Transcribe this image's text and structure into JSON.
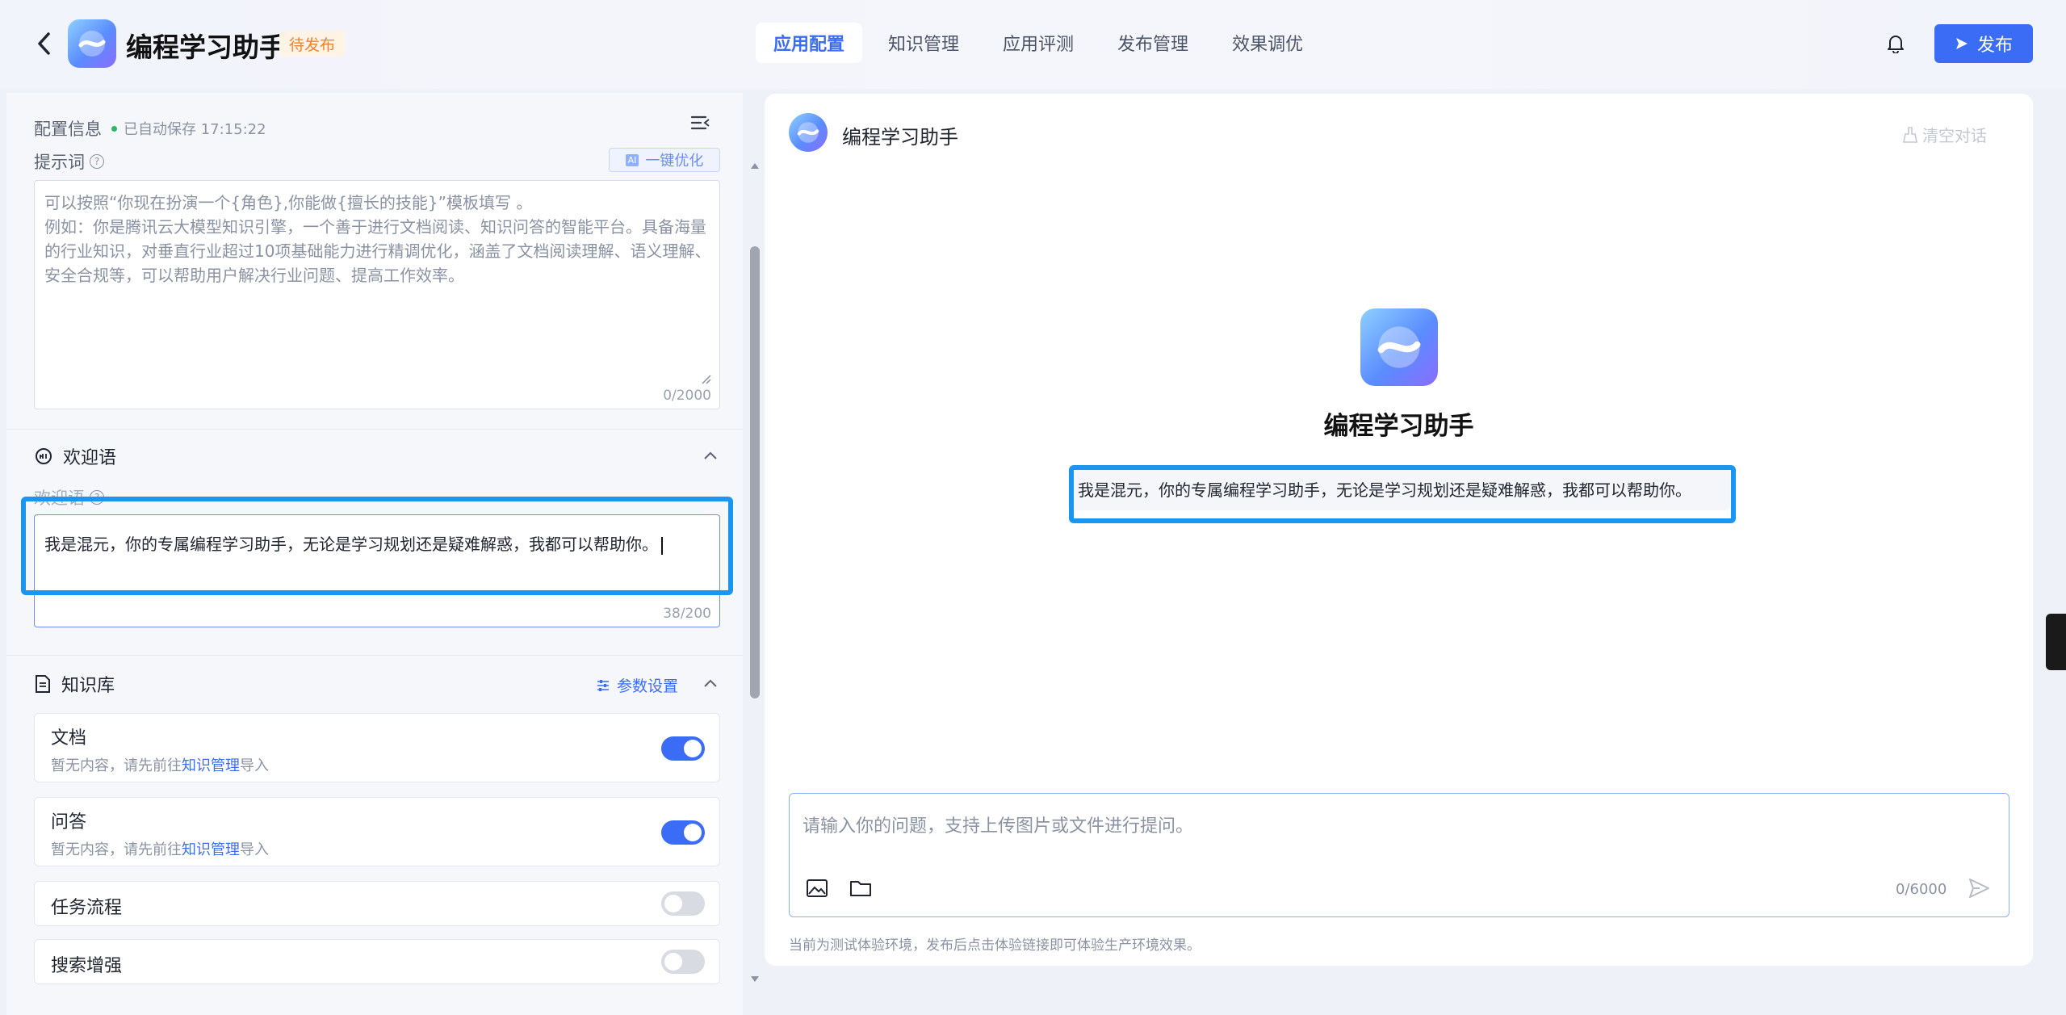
{
  "header": {
    "app_title": "编程学习助手",
    "status_badge": "待发布",
    "tabs": [
      {
        "label": "应用配置",
        "active": true
      },
      {
        "label": "知识管理",
        "active": false
      },
      {
        "label": "应用评测",
        "active": false
      },
      {
        "label": "发布管理",
        "active": false
      },
      {
        "label": "效果调优",
        "active": false
      }
    ],
    "publish_label": "发布"
  },
  "left": {
    "config_title": "配置信息",
    "autosave": "已自动保存 17:15:22",
    "prompt": {
      "label": "提示词",
      "optimize_label": "一键优化",
      "optimize_ai": "AI",
      "placeholder": "可以按照“你现在扮演一个{角色},你能做{擅长的技能}”模板填写 。\n例如：你是腾讯云大模型知识引擎，一个善于进行文档阅读、知识问答的智能平台。具备海量的行业知识，对垂直行业超过10项基础能力进行精调优化，涵盖了文档阅读理解、语义理解、安全合规等，可以帮助用户解决行业问题、提高工作效率。",
      "counter": "0/2000"
    },
    "welcome": {
      "section_title": "欢迎语",
      "field_label": "欢迎语",
      "value": "我是混元，你的专属编程学习助手，无论是学习规划还是疑难解惑，我都可以帮助你。",
      "counter": "38/200"
    },
    "knowledge": {
      "section_title": "知识库",
      "param_label": "参数设置",
      "items": [
        {
          "title": "文档",
          "desc_prefix": "暂无内容，请先前往",
          "desc_link": "知识管理",
          "desc_suffix": "导入",
          "enabled": true
        },
        {
          "title": "问答",
          "desc_prefix": "暂无内容，请先前往",
          "desc_link": "知识管理",
          "desc_suffix": "导入",
          "enabled": true
        },
        {
          "title": "任务流程",
          "enabled": false
        },
        {
          "title": "搜索增强",
          "enabled": false
        }
      ]
    }
  },
  "right": {
    "chat_title": "编程学习助手",
    "clear_label": "清空对话",
    "center_title": "编程学习助手",
    "welcome_message": "我是混元，你的专属编程学习助手，无论是学习规划还是疑难解惑，我都可以帮助你。",
    "input_placeholder": "请输入你的问题，支持上传图片或文件进行提问。",
    "input_counter": "0/6000",
    "footnote": "当前为测试体验环境，发布后点击体验链接即可体验生产环境效果。"
  },
  "colors": {
    "accent": "#3a6cf5",
    "highlight": "#1a96f0",
    "badge_text": "#f0822c"
  }
}
